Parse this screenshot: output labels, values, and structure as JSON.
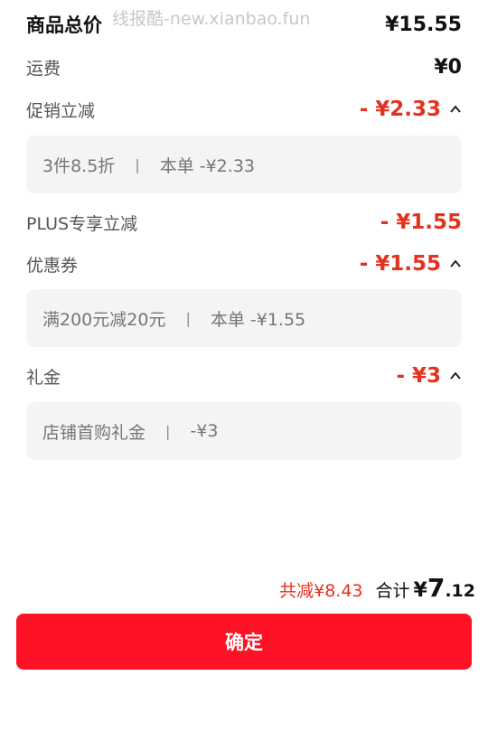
{
  "watermark": "线报酷-new.xianbao.fun",
  "total_price": {
    "label": "商品总价",
    "value": "¥15.55"
  },
  "shipping": {
    "label": "运费",
    "value": "¥0"
  },
  "promo": {
    "label": "促销立减",
    "value": "- ¥2.33",
    "detail_left": "3件8.5折",
    "separator": "|",
    "detail_right": "本单 -¥2.33"
  },
  "plus": {
    "label": "PLUS专享立减",
    "value": "- ¥1.55"
  },
  "coupon": {
    "label": "优惠券",
    "value": "- ¥1.55",
    "detail_left": "满200元减20元",
    "separator": "|",
    "detail_right": "本单 -¥1.55"
  },
  "gift": {
    "label": "礼金",
    "value": "- ¥3",
    "detail_left": "店铺首购礼金",
    "separator": "|",
    "detail_right": "-¥3"
  },
  "summary": {
    "saved": "共减¥8.43",
    "total_label": "合计",
    "total_yen": "¥",
    "total_int": "7",
    "total_dec": ".12"
  },
  "confirm_label": "确定",
  "colors": {
    "accent_red": "#e5311f",
    "button_red": "#ff1226"
  }
}
